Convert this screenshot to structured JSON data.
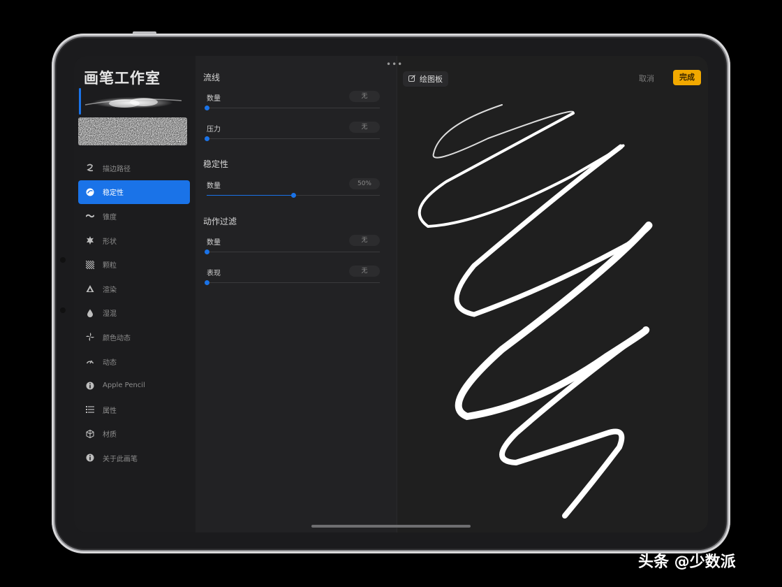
{
  "app": {
    "title": "画笔工作室"
  },
  "sidebar": {
    "items": [
      {
        "label": "描边路径",
        "icon": "stroke-path-icon"
      },
      {
        "label": "稳定性",
        "icon": "stabilization-icon",
        "active": true
      },
      {
        "label": "锥度",
        "icon": "taper-icon"
      },
      {
        "label": "形状",
        "icon": "shape-icon"
      },
      {
        "label": "颗粒",
        "icon": "grain-icon"
      },
      {
        "label": "渲染",
        "icon": "rendering-icon"
      },
      {
        "label": "湿混",
        "icon": "wet-mix-icon"
      },
      {
        "label": "颜色动态",
        "icon": "color-dynamics-icon"
      },
      {
        "label": "动态",
        "icon": "dynamics-icon"
      },
      {
        "label": "Apple Pencil",
        "icon": "info-icon"
      },
      {
        "label": "属性",
        "icon": "properties-icon"
      },
      {
        "label": "材质",
        "icon": "materials-icon"
      },
      {
        "label": "关于此画笔",
        "icon": "info-icon"
      }
    ]
  },
  "settings": {
    "sections": [
      {
        "title": "流线",
        "rows": [
          {
            "label": "数量",
            "value": "无",
            "level": 0
          },
          {
            "label": "压力",
            "value": "无",
            "level": 0
          }
        ]
      },
      {
        "title": "稳定性",
        "rows": [
          {
            "label": "数量",
            "value": "50%",
            "level": 0.5
          }
        ]
      },
      {
        "title": "动作过滤",
        "rows": [
          {
            "label": "数量",
            "value": "无",
            "level": 0
          },
          {
            "label": "表现",
            "value": "无",
            "level": 0
          }
        ]
      }
    ]
  },
  "canvas": {
    "drawing_pad_label": "绘图板",
    "cancel_label": "取消",
    "done_label": "完成",
    "more_label": "•••"
  },
  "colors": {
    "accent": "#1a73e8",
    "done": "#f2a900"
  },
  "watermark": "头条 @少数派"
}
